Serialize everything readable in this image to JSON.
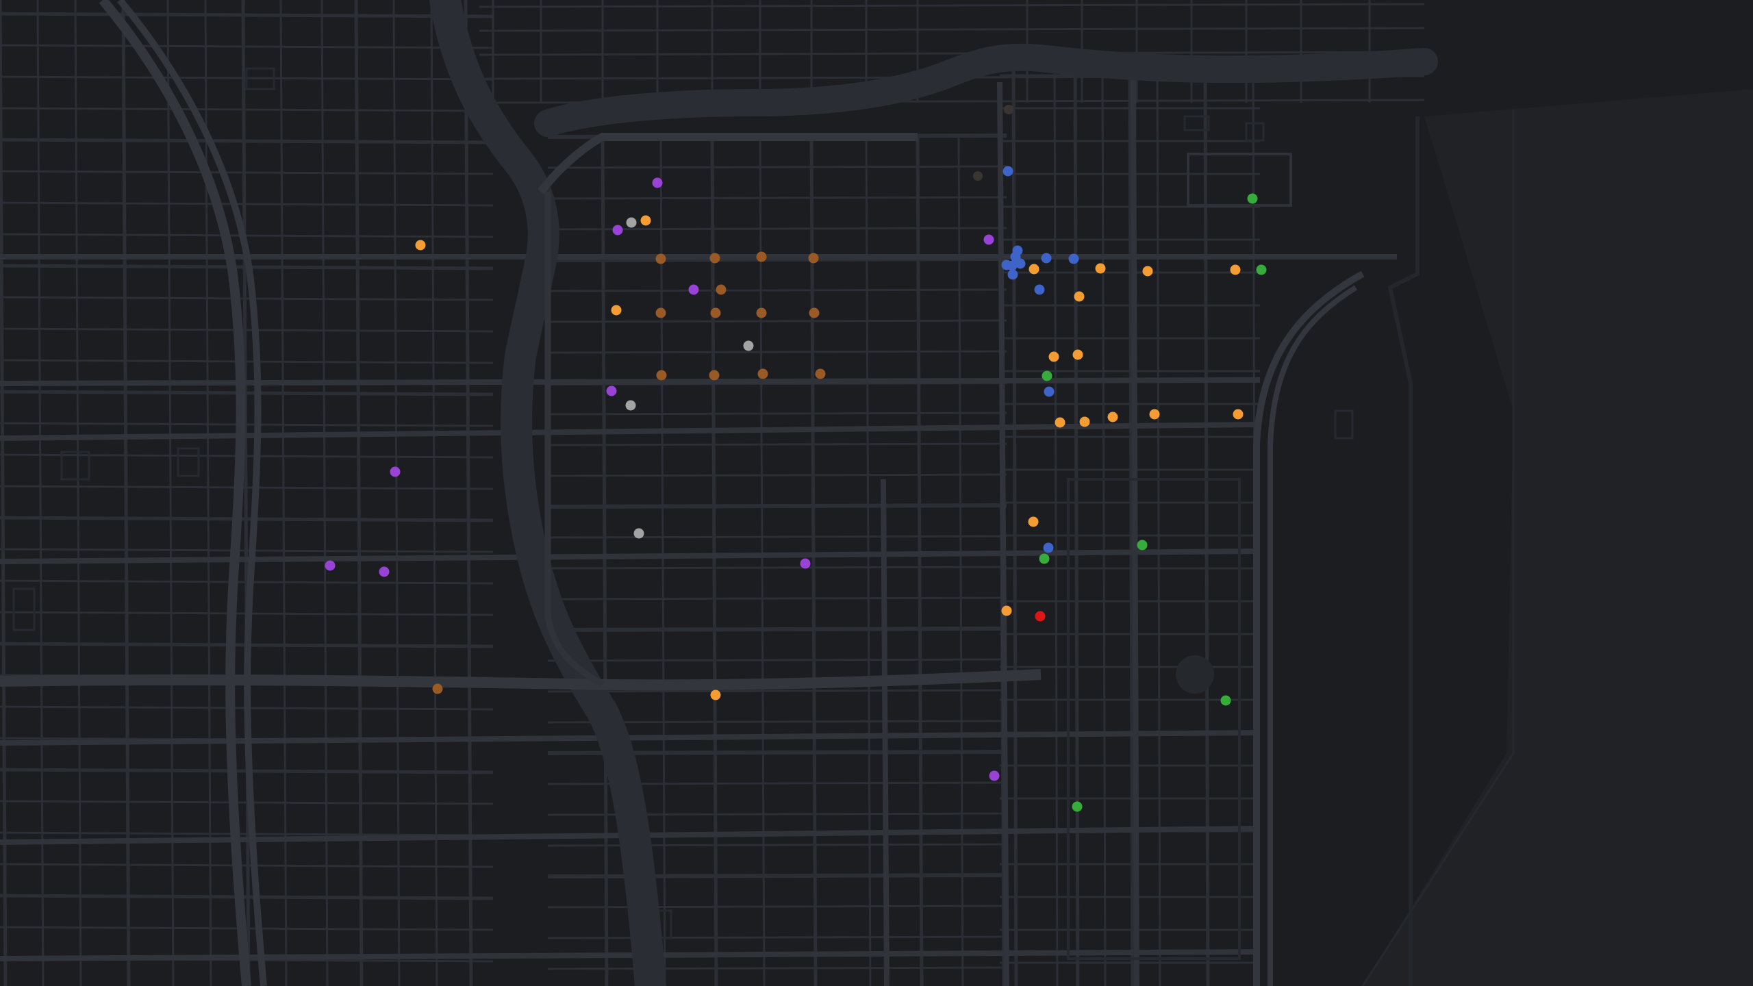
{
  "map": {
    "type": "dark street map with point markers",
    "colors": {
      "background": "#1b1d21",
      "block": "#1e2024",
      "lake": "#202226",
      "street": "#2b2e34",
      "arterial": "#30333a",
      "highway": "#33363d",
      "river": "#2a2d33",
      "footprint": "#262930"
    },
    "marker_categories": [
      {
        "key": "orange",
        "color": "#f59d32"
      },
      {
        "key": "brown",
        "color": "#9a5a26"
      },
      {
        "key": "purple",
        "color": "#9842d6"
      },
      {
        "key": "blue",
        "color": "#3e63c9"
      },
      {
        "key": "green",
        "color": "#36ad3a"
      },
      {
        "key": "gray",
        "color": "#a3a3a3"
      },
      {
        "key": "red",
        "color": "#e01515"
      },
      {
        "key": "dark",
        "color": "#3a3530"
      }
    ]
  }
}
